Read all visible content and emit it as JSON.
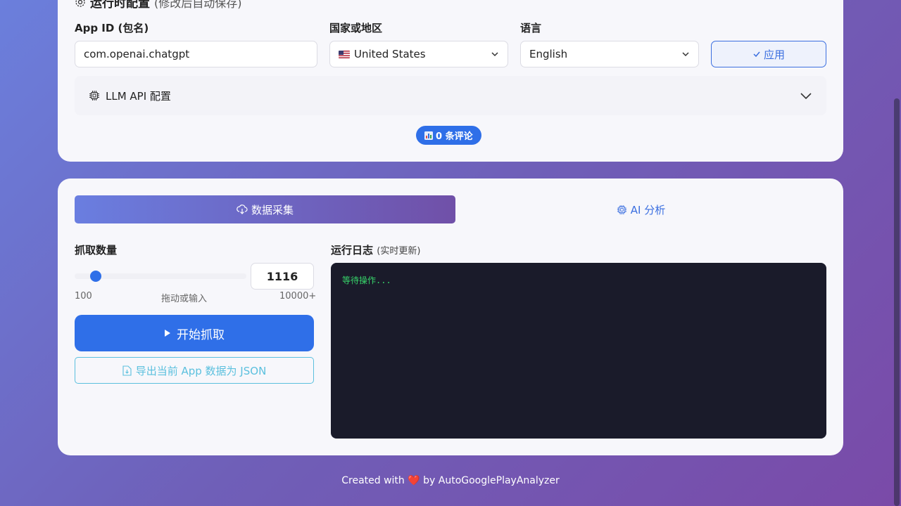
{
  "config": {
    "title": "运行时配置",
    "title_sub": "(修改后自动保存)",
    "app_id_label": "App ID (包名)",
    "app_id_value": "com.openai.chatgpt",
    "country_label": "国家或地区",
    "country_value": "United States",
    "language_label": "语言",
    "language_value": "English",
    "apply_label": "应用",
    "llm_label": "LLM API 配置",
    "review_count": "0 条评论"
  },
  "tabs": {
    "collect": "数据采集",
    "analyze": "AI 分析"
  },
  "fetch": {
    "label": "抓取数量",
    "value": "1116",
    "min_label": "100",
    "hint": "拖动或输入",
    "max_label": "10000+",
    "start_label": "开始抓取",
    "export_label": "导出当前 App 数据为 JSON"
  },
  "log": {
    "title": "运行日志",
    "title_sub": "(实时更新)",
    "content": "等待操作..."
  },
  "footer": {
    "prefix": "Created with",
    "suffix": "by AutoGooglePlayAnalyzer"
  },
  "colors": {
    "accent": "#2f6fe8",
    "log_text": "#37d46a",
    "log_bg": "#1a1b2a"
  }
}
